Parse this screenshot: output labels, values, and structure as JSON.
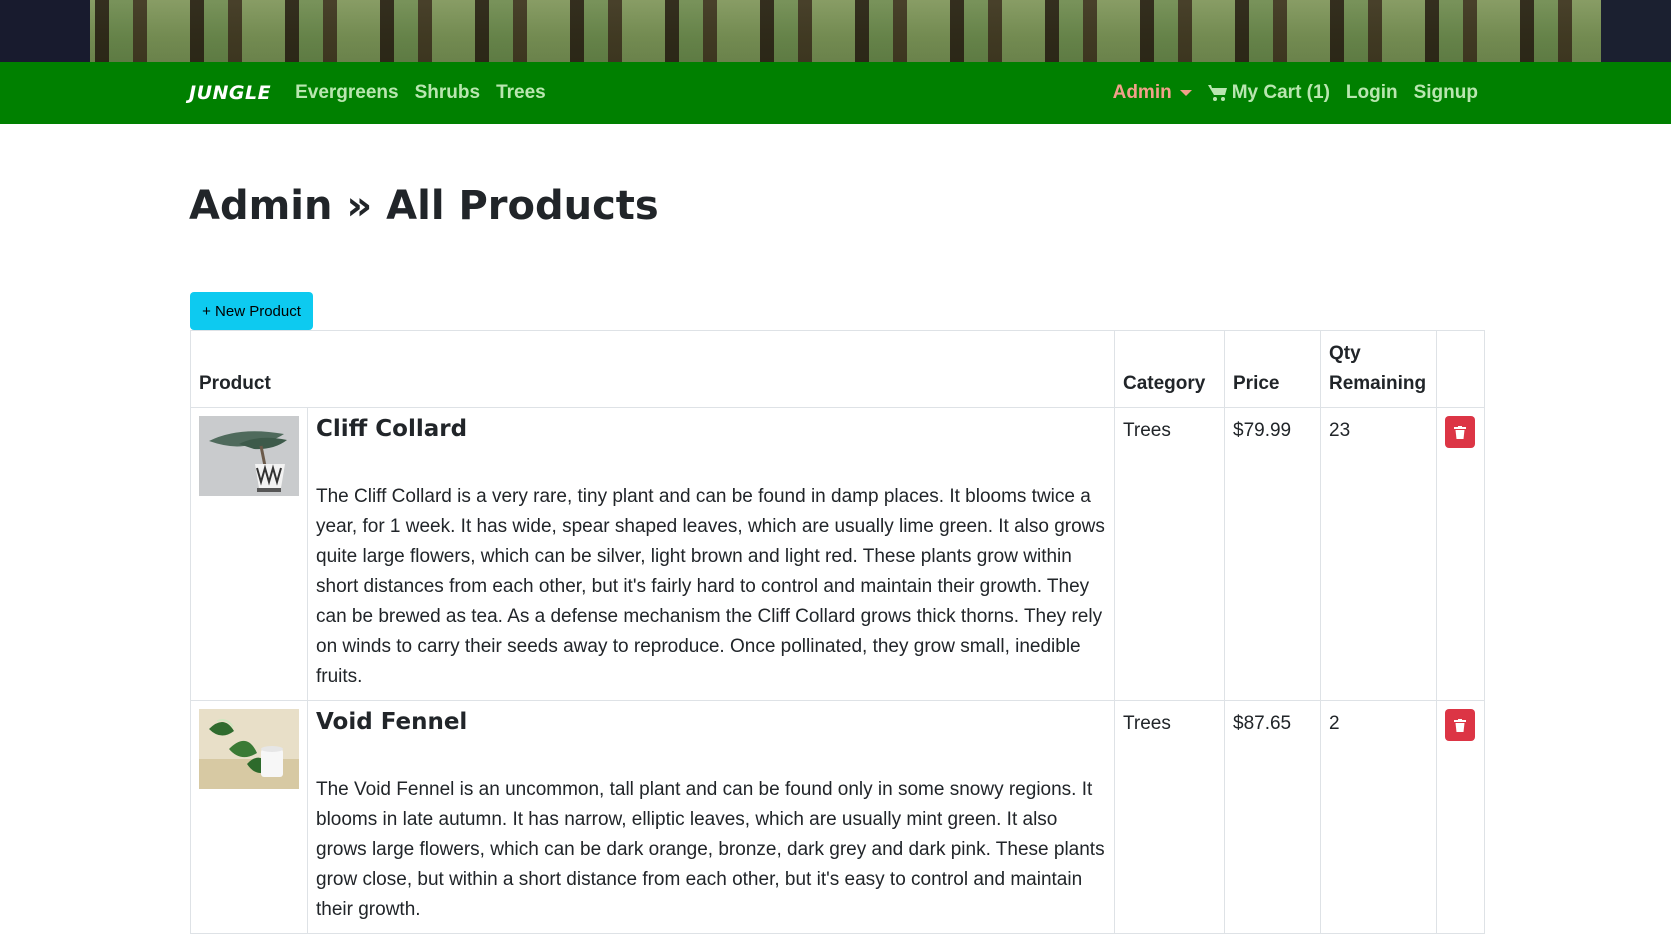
{
  "nav": {
    "brand": "JUNGLE",
    "links": [
      "Evergreens",
      "Shrubs",
      "Trees"
    ],
    "admin_label": "Admin",
    "cart_label": "My Cart (1)",
    "login_label": "Login",
    "signup_label": "Signup"
  },
  "page": {
    "title": "Admin » All Products",
    "new_product_label": "+ New Product"
  },
  "table": {
    "headers": {
      "product": "Product",
      "category": "Category",
      "price": "Price",
      "qty": "Qty Remaining"
    },
    "rows": [
      {
        "name": "Cliff Collard",
        "description": "The Cliff Collard is a very rare, tiny plant and can be found in damp places. It blooms twice a year, for 1 week. It has wide, spear shaped leaves, which are usually lime green. It also grows quite large flowers, which can be silver, light brown and light red. These plants grow within short distances from each other, but it's fairly hard to control and maintain their growth. They can be brewed as tea. As a defense mechanism the Cliff Collard grows thick thorns. They rely on winds to carry their seeds away to reproduce. Once pollinated, they grow small, inedible fruits.",
        "category": "Trees",
        "price": "$79.99",
        "qty": "23",
        "image": "bonsai-plant-icon"
      },
      {
        "name": "Void Fennel",
        "description": "The Void Fennel is an uncommon, tall plant and can be found only in some snowy regions. It blooms in late autumn. It has narrow, elliptic leaves, which are usually mint green. It also grows large flowers, which can be dark orange, bronze, dark grey and dark pink. These plants grow close, but within a short distance from each other, but it's easy to control and maintain their growth.",
        "category": "Trees",
        "price": "$87.65",
        "qty": "2",
        "image": "pothos-plant-icon"
      }
    ]
  },
  "colors": {
    "navbar": "#008000",
    "admin": "#f2a08a",
    "nav_link": "#b9e6b0",
    "new_button": "#0dcaf0",
    "delete_button": "#dc3545"
  }
}
